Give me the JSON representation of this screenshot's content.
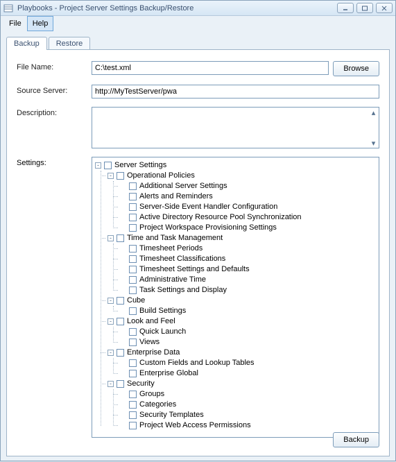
{
  "window": {
    "title": "Playbooks - Project Server Settings Backup/Restore"
  },
  "menu": {
    "file": "File",
    "help": "Help"
  },
  "tabs": {
    "backup": "Backup",
    "restore": "Restore"
  },
  "form": {
    "file_label": "File Name:",
    "file_value": "C:\\test.xml",
    "browse": "Browse",
    "source_label": "Source Server:",
    "source_value": "http://MyTestServer/pwa",
    "description_label": "Description:",
    "description_value": "",
    "settings_label": "Settings:"
  },
  "tree": {
    "root": "Server Settings",
    "groups": [
      {
        "label": "Operational Policies",
        "items": [
          "Additional Server Settings",
          "Alerts and Reminders",
          "Server-Side Event Handler Configuration",
          "Active Directory Resource Pool Synchronization",
          "Project Workspace Provisioning Settings"
        ]
      },
      {
        "label": "Time and Task Management",
        "items": [
          "Timesheet Periods",
          "Timesheet Classifications",
          "Timesheet Settings and Defaults",
          "Administrative Time",
          "Task Settings and Display"
        ]
      },
      {
        "label": "Cube",
        "items": [
          "Build Settings"
        ]
      },
      {
        "label": "Look and Feel",
        "items": [
          "Quick Launch",
          "Views"
        ]
      },
      {
        "label": "Enterprise Data",
        "items": [
          "Custom Fields and Lookup Tables",
          "Enterprise Global"
        ]
      },
      {
        "label": "Security",
        "items": [
          "Groups",
          "Categories",
          "Security Templates",
          "Project Web Access Permissions"
        ]
      }
    ]
  },
  "buttons": {
    "backup": "Backup"
  }
}
